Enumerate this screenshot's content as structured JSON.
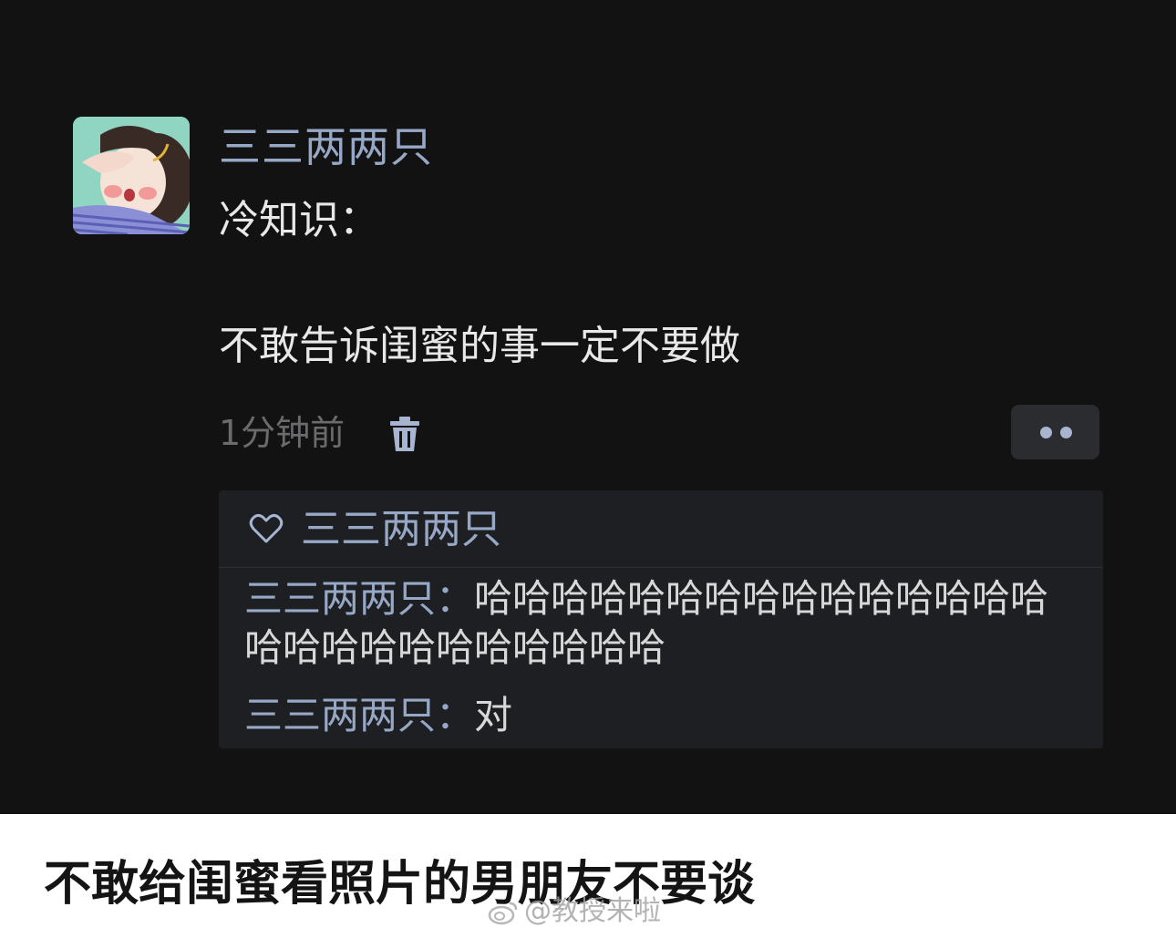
{
  "post": {
    "author": "三三两两只",
    "text_line1": "冷知识：",
    "text_line2": "不敢告诉闺蜜的事一定不要做",
    "time": "1分钟前"
  },
  "icons": {
    "avatar": "avatar-cartoon-girl",
    "delete": "trash-icon",
    "more": "more-dots-icon",
    "like": "heart-icon",
    "watermark_logo": "weibo-logo-icon"
  },
  "likes": {
    "names": "三三两两只"
  },
  "comments": [
    {
      "author": "三三两两只",
      "separator": "：",
      "text": "哈哈哈哈哈哈哈哈哈哈哈哈哈哈哈哈哈哈哈哈哈哈哈哈哈哈"
    },
    {
      "author": "三三两两只",
      "separator": "：",
      "text": "对"
    }
  ],
  "caption": "不敢给闺蜜看照片的男朋友不要谈",
  "watermark": "@教授来啦",
  "colors": {
    "background": "#121213",
    "name_blue": "#97a8c6",
    "text": "#e8e8e8",
    "muted": "#6b6b6e",
    "comment_bg": "#1e1f22"
  }
}
